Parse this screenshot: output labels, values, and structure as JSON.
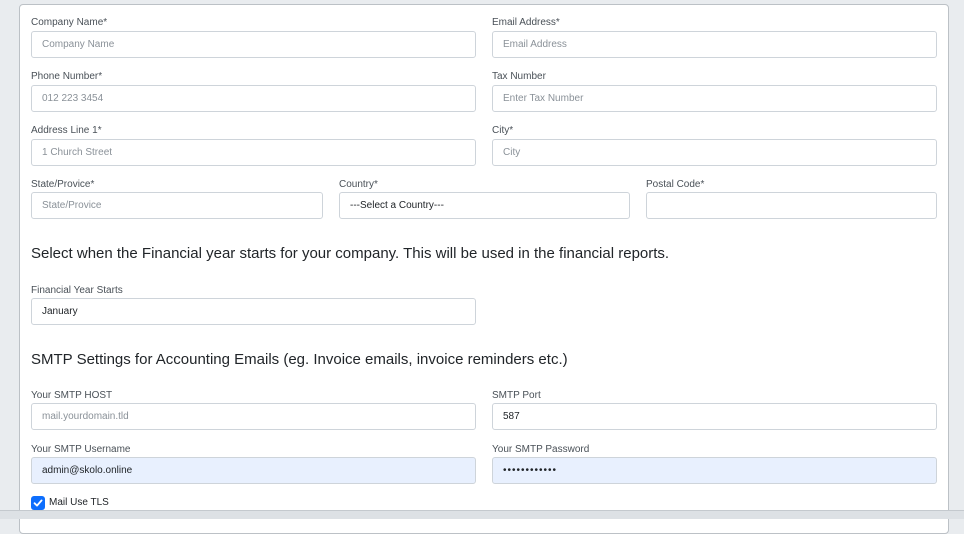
{
  "company": {
    "company_name": {
      "label": "Company Name*",
      "placeholder": "Company Name"
    },
    "email": {
      "label": "Email Address*",
      "placeholder": "Email Address"
    },
    "phone": {
      "label": "Phone Number*",
      "placeholder": "012 223 3454"
    },
    "tax": {
      "label": "Tax Number",
      "placeholder": "Enter Tax Number"
    },
    "address": {
      "label": "Address Line 1*",
      "placeholder": "1 Church Street"
    },
    "city": {
      "label": "City*",
      "placeholder": "City"
    },
    "state": {
      "label": "State/Provice*",
      "placeholder": "State/Provice"
    },
    "country": {
      "label": "Country*",
      "value": "---Select a Country---"
    },
    "postal": {
      "label": "Postal Code*",
      "placeholder": ""
    }
  },
  "financial": {
    "heading": "Select when the Financial year starts for your company. This will be used in the financial reports.",
    "label": "Financial Year Starts",
    "value": "January"
  },
  "smtp": {
    "heading": "SMTP Settings for Accounting Emails (eg. Invoice emails, invoice reminders etc.)",
    "host": {
      "label": "Your SMTP HOST",
      "placeholder": "mail.yourdomain.tld"
    },
    "port": {
      "label": "SMTP Port",
      "value": "587"
    },
    "username": {
      "label": "Your SMTP Username",
      "value": "admin@skolo.online"
    },
    "password": {
      "label": "Your SMTP Password",
      "value": "••••••••••••"
    },
    "tls": {
      "label": "Mail Use TLS",
      "checked": true
    }
  },
  "colors": {
    "accent": "#0d6efd",
    "autofill": "#e8f0fe"
  }
}
